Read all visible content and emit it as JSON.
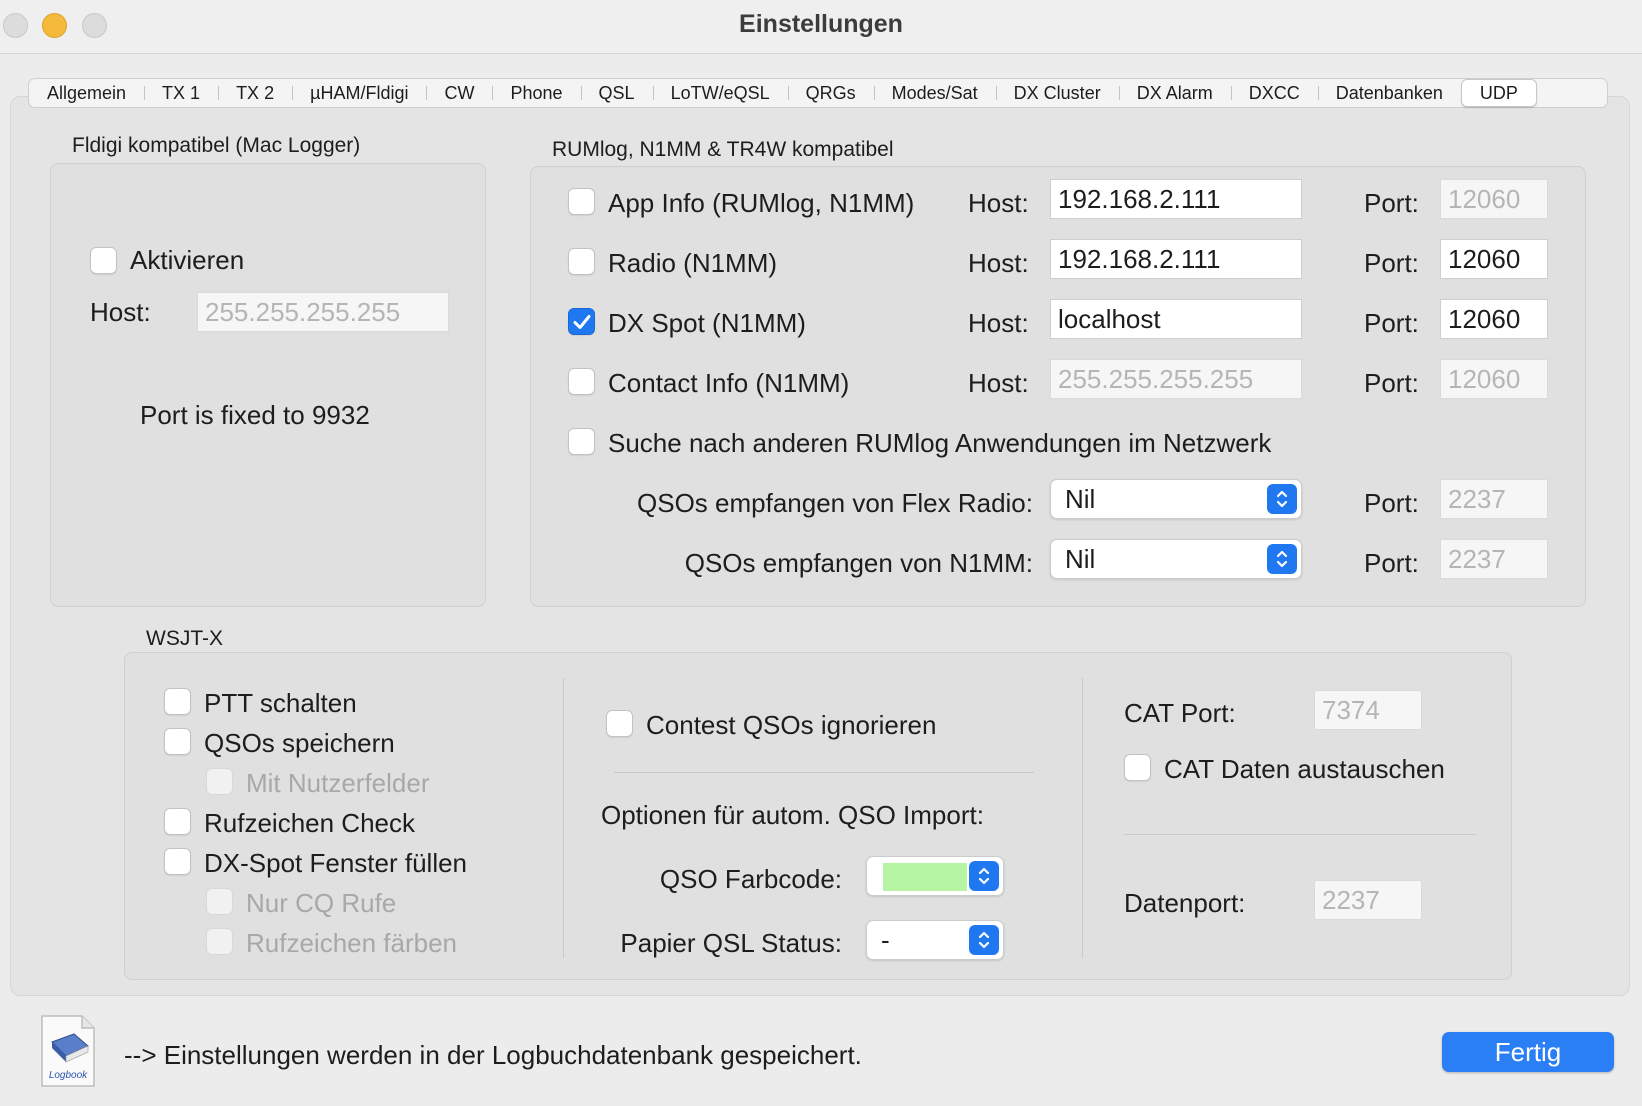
{
  "window": {
    "title": "Einstellungen"
  },
  "tabs": [
    "Allgemein",
    "TX 1",
    "TX 2",
    "µHAM/Fldigi",
    "CW",
    "Phone",
    "QSL",
    "LoTW/eQSL",
    "QRGs",
    "Modes/Sat",
    "DX Cluster",
    "DX Alarm",
    "DXCC",
    "Datenbanken",
    "UDP"
  ],
  "active_tab": "UDP",
  "fldigi": {
    "title": "Fldigi kompatibel (Mac Logger)",
    "activate_label": "Aktivieren",
    "activate_checked": false,
    "host_label": "Host:",
    "host_value": "255.255.255.255",
    "port_note": "Port is fixed to 9932"
  },
  "rumlog": {
    "title": "RUMlog, N1MM & TR4W kompatibel",
    "host_label": "Host:",
    "port_label": "Port:",
    "rows": [
      {
        "label": "App Info (RUMlog, N1MM)",
        "checked": false,
        "host": "192.168.2.111",
        "port": "12060",
        "host_enabled": true,
        "port_enabled": false
      },
      {
        "label": "Radio (N1MM)",
        "checked": false,
        "host": "192.168.2.111",
        "port": "12060",
        "host_enabled": true,
        "port_enabled": true
      },
      {
        "label": "DX Spot (N1MM)",
        "checked": true,
        "host": "localhost",
        "port": "12060",
        "host_enabled": true,
        "port_enabled": true
      },
      {
        "label": "Contact Info (N1MM)",
        "checked": false,
        "host": "255.255.255.255",
        "port": "12060",
        "host_enabled": false,
        "port_enabled": false
      }
    ],
    "search_label": "Suche nach anderen RUMlog Anwendungen im Netzwerk",
    "flex_label": "QSOs empfangen von Flex Radio:",
    "flex_value": "Nil",
    "flex_port": "2237",
    "n1mm_label": "QSOs empfangen von N1MM:",
    "n1mm_value": "Nil",
    "n1mm_port": "2237"
  },
  "wsjtx": {
    "title": "WSJT-X",
    "ptt": "PTT schalten",
    "save_qsos": "QSOs speichern",
    "user_fields": "Mit Nutzerfelder",
    "callsign_check": "Rufzeichen Check",
    "dx_spot_fill": "DX-Spot Fenster füllen",
    "cq_only": "Nur CQ Rufe",
    "color_calls": "Rufzeichen färben",
    "ignore_contest": "Contest QSOs ignorieren",
    "import_options": "Optionen für autom. QSO Import:",
    "color_code_label": "QSO Farbcode:",
    "color_code_value": "#b6f5a3",
    "paper_qsl_label": "Papier QSL Status:",
    "paper_qsl_value": "-",
    "cat_port_label": "CAT Port:",
    "cat_port_value": "7374",
    "cat_exchange": "CAT Daten austauschen",
    "data_port_label": "Datenport:",
    "data_port_value": "2237"
  },
  "footer": {
    "logbook_icon_text": "Logbook",
    "note": "--> Einstellungen werden in der Logbuchdatenbank gespeichert.",
    "done_label": "Fertig"
  }
}
